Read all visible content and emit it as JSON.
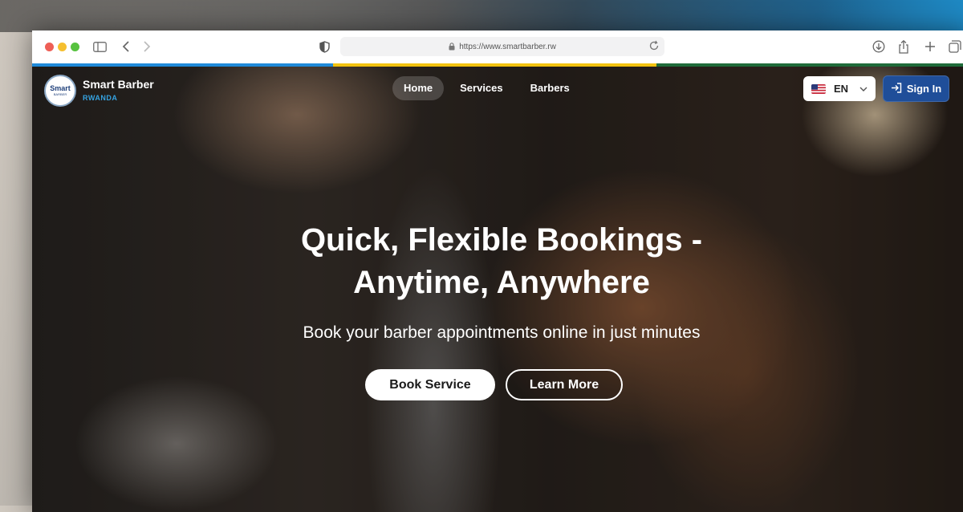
{
  "browser": {
    "url": "https://www.smartbarber.rw"
  },
  "brand": {
    "logo_top": "Smart",
    "logo_sub": "BARBER",
    "name": "Smart Barber",
    "country": "RWANDA"
  },
  "nav": {
    "items": [
      {
        "label": "Home",
        "active": true
      },
      {
        "label": "Services",
        "active": false
      },
      {
        "label": "Barbers",
        "active": false
      }
    ]
  },
  "language": {
    "selected": "EN",
    "flag_icon": "us-flag-icon"
  },
  "signin": {
    "label": "Sign In"
  },
  "hero": {
    "headline_line1": "Quick, Flexible Bookings -",
    "headline_line2": "Anytime, Anywhere",
    "subline": "Book your barber appointments online in just minutes",
    "primary_button": "Book Service",
    "secondary_button": "Learn More"
  },
  "colors": {
    "signin_bg": "#1f4e99",
    "brand_accent": "#35a2e0",
    "flag_blue": "#1f8ad9",
    "flag_yellow": "#f2c20f",
    "flag_green": "#1f6b3a"
  }
}
